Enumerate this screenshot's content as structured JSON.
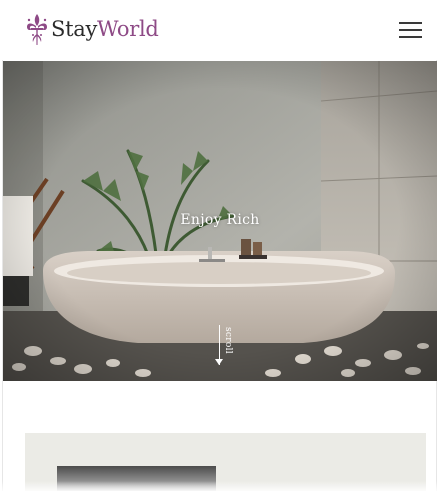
{
  "brand": {
    "name_part1": "Stay",
    "name_part2": "World",
    "logo_icon": "fleur-de-lis-icon",
    "accent_color": "#8e4a86",
    "text_color": "#2b2b2b"
  },
  "header": {
    "menu_icon": "hamburger-menu-icon"
  },
  "hero": {
    "title": "Enjoy Rich",
    "scroll_label": "scroll",
    "image_subject": "freestanding bathtub with palm plant"
  },
  "content": {
    "card_background": "#ebebe6"
  }
}
